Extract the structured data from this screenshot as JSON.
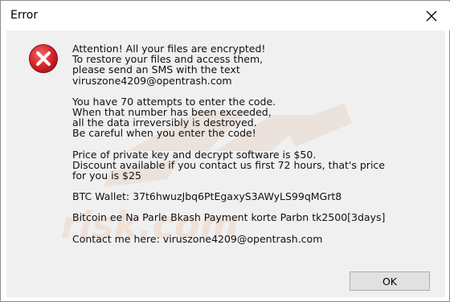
{
  "window": {
    "title": "Error",
    "close_icon": "close-icon"
  },
  "dialog": {
    "icon": "error-icon",
    "paragraphs": [
      "Attention! All your files are encrypted!\nTo restore your files and access them,\nplease send an SMS with the text\nviruszone4209@opentrash.com",
      "You have 70 attempts to enter the code.\nWhen that number has been exceeded,\nall the data irreversibly is destroyed.\nBe careful when you enter the code!",
      "Price of private key and decrypt software is $50.\nDiscount  available if you contact us first 72 hours, that's price\nfor you is $25",
      "BTC Wallet: 37t6hwuzJbq6PtEgaxyS3AWyLS99qMGrt8",
      "Bitcoin ee Na Parle Bkash Payment korte Parbn tk2500[3days]",
      "Contact me here: viruszone4209@opentrash.com"
    ],
    "ok_label": "OK"
  },
  "colors": {
    "icon_red": "#d6252b",
    "button_bg": "#e1e1e1",
    "client_bg": "#f0f0f0"
  }
}
